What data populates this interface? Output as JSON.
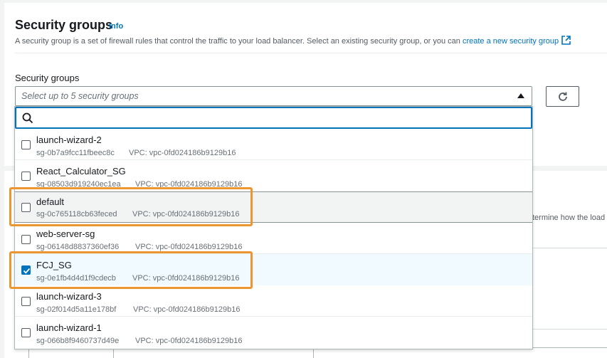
{
  "panel": {
    "title": "Security groups",
    "info": "Info",
    "description": "A security group is a set of firewall rules that control the traffic to your load balancer. Select an existing security group, or you can ",
    "create_link": "create a new security group",
    "field_label": "Security groups"
  },
  "select": {
    "placeholder": "Select up to 5 security groups",
    "search_value": ""
  },
  "background": {
    "partial_text": "termine how the load"
  },
  "options": [
    {
      "name": "launch-wizard-2",
      "id": "sg-0b7a9fcc11fbeec8c",
      "vpc": "VPC: vpc-0fd024186b9129b16",
      "checked": false
    },
    {
      "name": "React_Calculator_SG",
      "id": "sg-08503d919240ec1ea",
      "vpc": "VPC: vpc-0fd024186b9129b16",
      "checked": false
    },
    {
      "name": "default",
      "id": "sg-0c765118cb63feced",
      "vpc": "VPC: vpc-0fd024186b9129b16",
      "checked": false
    },
    {
      "name": "web-server-sg",
      "id": "sg-06148d8837360ef36",
      "vpc": "VPC: vpc-0fd024186b9129b16",
      "checked": false
    },
    {
      "name": "FCJ_SG",
      "id": "sg-0e1fb4d4d1f9cdecb",
      "vpc": "VPC: vpc-0fd024186b9129b16",
      "checked": true
    },
    {
      "name": "launch-wizard-3",
      "id": "sg-02f014d5a11e178bf",
      "vpc": "VPC: vpc-0fd024186b9129b16",
      "checked": false
    },
    {
      "name": "launch-wizard-1",
      "id": "sg-066b8f9460737d49e",
      "vpc": "VPC: vpc-0fd024186b9129b16",
      "checked": false
    }
  ],
  "icons": {
    "external": "external-link-icon",
    "refresh": "refresh-icon",
    "search": "search-icon",
    "caret": "caret-up-icon",
    "check": "check-icon"
  },
  "colors": {
    "accent": "#0073bb",
    "highlight": "#ec9630"
  }
}
